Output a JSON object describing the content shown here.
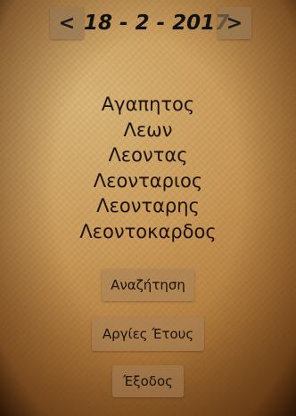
{
  "nav": {
    "prev_icon": "chevron-left-icon",
    "prev_glyph": "<",
    "date": "18 - 2 - 2017",
    "next_icon": "chevron-right-icon",
    "next_glyph": ">"
  },
  "names": [
    "Αγαπητος",
    "Λεων",
    "Λεοντας",
    "Λεονταριος",
    "Λεονταρης",
    "Λεοντοκαρδος"
  ],
  "buttons": {
    "search": "Αναζήτηση",
    "holidays": "Αργίες Έτους",
    "exit": "Έξοδος"
  }
}
